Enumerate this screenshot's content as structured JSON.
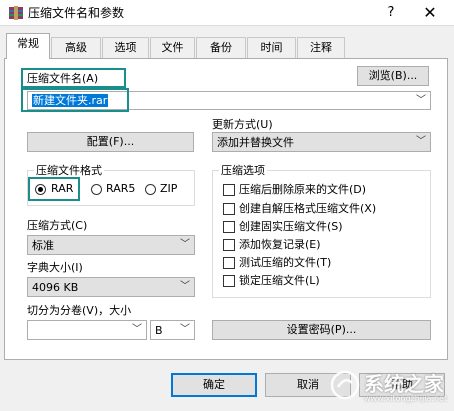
{
  "window": {
    "title": "压缩文件名和参数",
    "help": "?",
    "close": "✕"
  },
  "tabs": [
    {
      "label": "常规",
      "active": true
    },
    {
      "label": "高级"
    },
    {
      "label": "选项"
    },
    {
      "label": "文件"
    },
    {
      "label": "备份"
    },
    {
      "label": "时间"
    },
    {
      "label": "注释"
    }
  ],
  "archive_name": {
    "label": "压缩文件名(A)",
    "value": "新建文件夹.rar",
    "browse_button": "浏览(B)..."
  },
  "profiles_button": "配置(F)...",
  "update_mode": {
    "label": "更新方式(U)",
    "value": "添加并替换文件"
  },
  "archive_format": {
    "label": "压缩文件格式",
    "options": [
      {
        "label": "RAR",
        "checked": true
      },
      {
        "label": "RAR5",
        "checked": false
      },
      {
        "label": "ZIP",
        "checked": false
      }
    ]
  },
  "compression_method": {
    "label": "压缩方式(C)",
    "value": "标准"
  },
  "dictionary_size": {
    "label": "字典大小(I)",
    "value": "4096 KB"
  },
  "split_volumes": {
    "label": "切分为分卷(V)，大小",
    "value": "",
    "unit": "B"
  },
  "archive_options": {
    "label": "压缩选项",
    "items": [
      {
        "label": "压缩后删除原来的文件(D)",
        "checked": false
      },
      {
        "label": "创建自解压格式压缩文件(X)",
        "checked": false
      },
      {
        "label": "创建固实压缩文件(S)",
        "checked": false
      },
      {
        "label": "添加恢复记录(E)",
        "checked": false
      },
      {
        "label": "测试压缩的文件(T)",
        "checked": false
      },
      {
        "label": "锁定压缩文件(L)",
        "checked": false
      }
    ]
  },
  "set_password_button": "设置密码(P)...",
  "buttons": {
    "ok": "确定",
    "cancel": "取消",
    "help": "帮助"
  },
  "watermark": {
    "text": "系统之家",
    "url": "www.xitongzhijia.net"
  },
  "colors": {
    "highlight": "#1a8d8d",
    "selection": "#0078d7"
  }
}
